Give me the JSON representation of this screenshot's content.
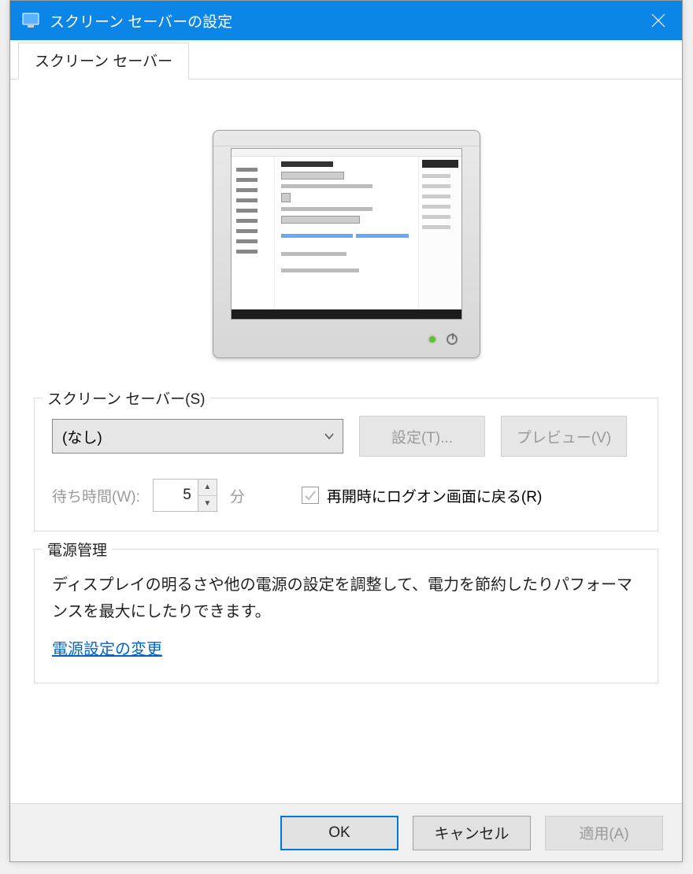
{
  "window": {
    "title": "スクリーン セーバーの設定"
  },
  "tab": {
    "label": "スクリーン セーバー"
  },
  "screensaver_group": {
    "legend": "スクリーン セーバー(S)",
    "selected": "(なし)",
    "settings_button": "設定(T)...",
    "preview_button": "プレビュー(V)",
    "wait_label": "待ち時間(W):",
    "wait_value": "5",
    "wait_unit": "分",
    "resume_checkbox_label": "再開時にログオン画面に戻る(R)"
  },
  "power_group": {
    "legend": "電源管理",
    "description": "ディスプレイの明るさや他の電源の設定を調整して、電力を節約したりパフォーマンスを最大にしたりできます。",
    "link": "電源設定の変更"
  },
  "footer": {
    "ok": "OK",
    "cancel": "キャンセル",
    "apply": "適用(A)"
  }
}
